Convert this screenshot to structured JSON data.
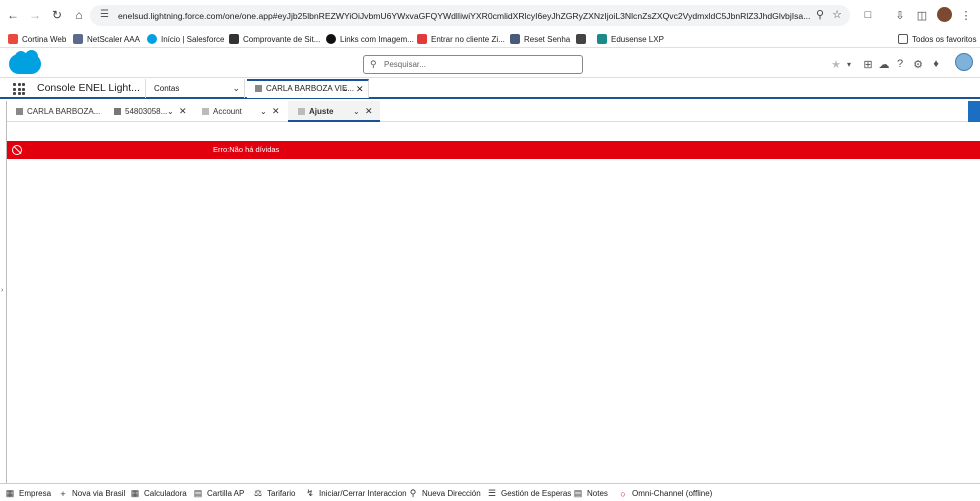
{
  "browser": {
    "url": "enelsud.lightning.force.com/one/one.app#eyJjb25lbnREZWYiOiJvbmU6YWxvaGFQYWdlIiwiYXR0cmlidXRlcyI6eyJhZGRyZXNzIjoiL3NlcnZsZXQvc2VydmxldC5JbnRlZ3JhdGlvbjIsa..."
  },
  "bookmarks": [
    {
      "label": "Cortina Web",
      "color": "#e84a3c"
    },
    {
      "label": "NetScaler AAA",
      "color": "#5a6b8c"
    },
    {
      "label": "Início | Salesforce",
      "color": "#00a1e0"
    },
    {
      "label": "Comprovante de Sit...",
      "color": "#333333"
    },
    {
      "label": "Links com Imagem...",
      "color": "#111111"
    },
    {
      "label": "Entrar no cliente Zi...",
      "color": "#e03a3a"
    },
    {
      "label": "Reset Senha",
      "color": "#4a5a7a"
    },
    {
      "label": "",
      "color": "#444444"
    },
    {
      "label": "Edusense LXP",
      "color": "#1d8a8a"
    },
    {
      "label": "Todos os favoritos",
      "color": "#555555"
    }
  ],
  "header": {
    "search_placeholder": "Pesquisar..."
  },
  "console": {
    "app_name": "Console ENEL Light...",
    "object_selector": "Contas",
    "workspace_tab": "CARLA BARBOZA VIE..."
  },
  "subtabs": [
    {
      "label": "CARLA BARBOZA..."
    },
    {
      "label": "54803058..."
    },
    {
      "label": "Account"
    },
    {
      "label": "Ajuste"
    }
  ],
  "error": {
    "message": "Erro:Não há dívidas"
  },
  "utility_bar": [
    {
      "label": "Empresa",
      "icon": "building-icon"
    },
    {
      "label": "Nova via Brasil",
      "icon": "plus-icon"
    },
    {
      "label": "Calculadora",
      "icon": "calculator-icon"
    },
    {
      "label": "Cartilla AP",
      "icon": "book-icon"
    },
    {
      "label": "Tarifario",
      "icon": "scale-icon"
    },
    {
      "label": "Iniciar/Cerrar Interaccion",
      "icon": "lightning-icon"
    },
    {
      "label": "Nueva Dirección",
      "icon": "pin-icon"
    },
    {
      "label": "Gestión de Esperas",
      "icon": "list-icon"
    },
    {
      "label": "Notes",
      "icon": "note-icon"
    },
    {
      "label": "Omni-Channel (offline)",
      "icon": "status-icon"
    }
  ]
}
